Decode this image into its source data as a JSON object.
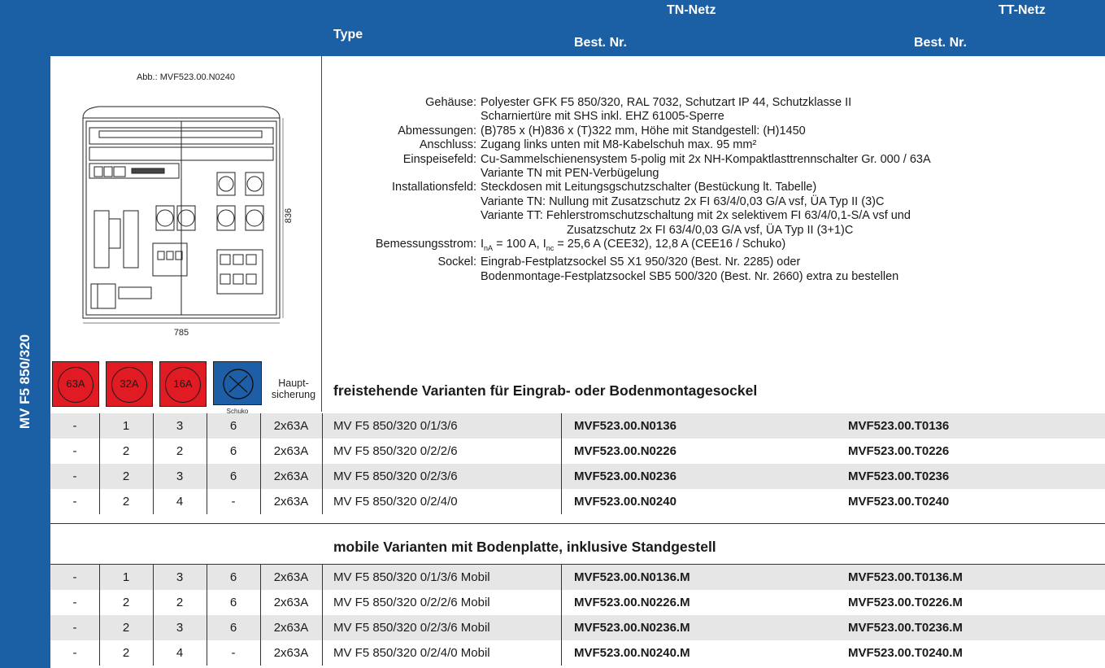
{
  "header": {
    "type_label": "Type",
    "tn_title": "TN-Netz",
    "tt_title": "TT-Netz",
    "tn_best": "Best. Nr.",
    "tt_best": "Best. Nr."
  },
  "side_label": "MV F5 850/320",
  "figure": {
    "caption": "Abb.: MVF523.00.N0240",
    "width_label": "785",
    "height_label": "836"
  },
  "specs": [
    {
      "key": "Gehäuse:",
      "value": "Polyester GFK F5 850/320, RAL 7032, Schutzart IP 44, Schutzklasse II"
    },
    {
      "key": "",
      "value": "Scharniertüre mit SHS inkl. EHZ 61005-Sperre"
    },
    {
      "key": "Abmessungen:",
      "value": "(B)785 x (H)836 x (T)322 mm, Höhe mit Standgestell: (H)1450"
    },
    {
      "key": "Anschluss:",
      "value": "Zugang links unten mit M8-Kabelschuh max. 95 mm²"
    },
    {
      "key": "Einspeisefeld:",
      "value": "Cu-Sammelschienensystem 5-polig mit 2x NH-Kompaktlasttrennschalter Gr. 000 / 63A"
    },
    {
      "key": "",
      "value": "Variante TN mit PEN-Verbügelung"
    },
    {
      "key": "Installationsfeld:",
      "value": "Steckdosen mit Leitungsgschutzschalter (Bestückung lt. Tabelle)"
    },
    {
      "key": "",
      "value": "Variante TN: Nullung mit Zusatzschutz 2x FI 63/4/0,03 G/A vsf, ÜA Typ II (3)C"
    },
    {
      "key": "",
      "value": "Variante TT:  Fehlerstromschutzschaltung mit 2x selektivem FI 63/4/0,1-S/A vsf und"
    },
    {
      "key": "",
      "value": "Zusatzschutz 2x FI 63/4/0,03 G/A vsf, ÜA Typ II (3+1)C",
      "indent": true
    },
    {
      "key": "Bemessungsstrom:",
      "value": "",
      "current": true
    },
    {
      "key": "Sockel:",
      "value": "Eingrab-Festplatzsockel S5 X1 950/320 (Best. Nr. 2285) oder"
    },
    {
      "key": "",
      "value": "Bodenmontage-Festplatzsockel SB5 500/320 (Best. Nr. 2660) extra zu bestellen"
    }
  ],
  "current": {
    "a": "I",
    "a_sub": "nA",
    "a_rest": " = 100 A, I",
    "b_sub": "nc",
    "b_rest": " = 25,6 A (CEE32), 12,8 A (CEE16 / Schuko)"
  },
  "icons": {
    "items": [
      {
        "label": "63A"
      },
      {
        "label": "32A"
      },
      {
        "label": "16A"
      }
    ],
    "schuko_label": "Schuko",
    "haupt_label_1": "Haupt-",
    "haupt_label_2": "sicherung",
    "colors": {
      "red": "#e01b24",
      "blue": "#1d5ea6"
    }
  },
  "groups": [
    {
      "title": "freistehende Varianten für Eingrab- oder Bodenmontagesockel",
      "rows": [
        {
          "c63": "-",
          "c32": "1",
          "c16": "3",
          "sch": "6",
          "hs": "2x63A",
          "type": "MV F5 850/320 0/1/3/6",
          "tn": "MVF523.00.N0136",
          "tt": "MVF523.00.T0136"
        },
        {
          "c63": "-",
          "c32": "2",
          "c16": "2",
          "sch": "6",
          "hs": "2x63A",
          "type": "MV F5 850/320 0/2/2/6",
          "tn": "MVF523.00.N0226",
          "tt": "MVF523.00.T0226"
        },
        {
          "c63": "-",
          "c32": "2",
          "c16": "3",
          "sch": "6",
          "hs": "2x63A",
          "type": "MV F5 850/320 0/2/3/6",
          "tn": "MVF523.00.N0236",
          "tt": "MVF523.00.T0236"
        },
        {
          "c63": "-",
          "c32": "2",
          "c16": "4",
          "sch": "-",
          "hs": "2x63A",
          "type": "MV F5 850/320 0/2/4/0",
          "tn": "MVF523.00.N0240",
          "tt": "MVF523.00.T0240"
        }
      ]
    },
    {
      "title": "mobile Varianten mit Bodenplatte, inklusive Standgestell",
      "rows": [
        {
          "c63": "-",
          "c32": "1",
          "c16": "3",
          "sch": "6",
          "hs": "2x63A",
          "type": "MV F5 850/320 0/1/3/6 Mobil",
          "tn": "MVF523.00.N0136.M",
          "tt": "MVF523.00.T0136.M"
        },
        {
          "c63": "-",
          "c32": "2",
          "c16": "2",
          "sch": "6",
          "hs": "2x63A",
          "type": "MV F5 850/320 0/2/2/6 Mobil",
          "tn": "MVF523.00.N0226.M",
          "tt": "MVF523.00.T0226.M"
        },
        {
          "c63": "-",
          "c32": "2",
          "c16": "3",
          "sch": "6",
          "hs": "2x63A",
          "type": "MV F5 850/320 0/2/3/6 Mobil",
          "tn": "MVF523.00.N0236.M",
          "tt": "MVF523.00.T0236.M"
        },
        {
          "c63": "-",
          "c32": "2",
          "c16": "4",
          "sch": "-",
          "hs": "2x63A",
          "type": "MV F5 850/320 0/2/4/0 Mobil",
          "tn": "MVF523.00.N0240.M",
          "tt": "MVF523.00.T0240.M"
        }
      ]
    }
  ]
}
